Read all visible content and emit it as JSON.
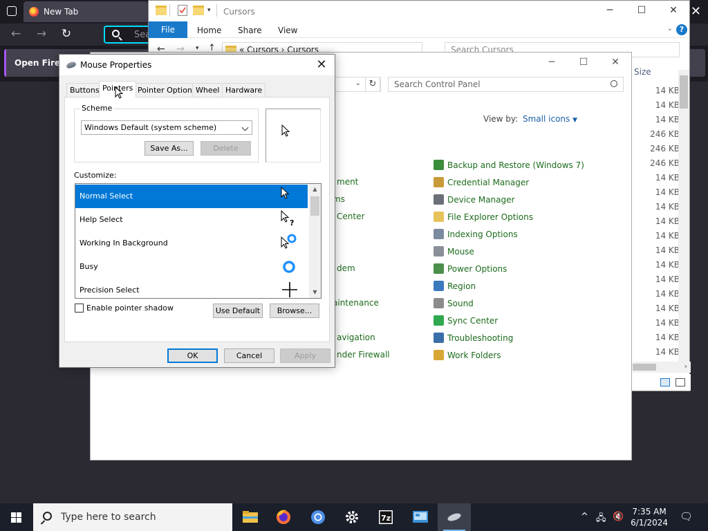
{
  "firefox": {
    "tab_title": "New Tab",
    "url_placeholder": "Sea",
    "notification": "Open Firefo"
  },
  "explorer": {
    "title": "Cursors",
    "ribbon": [
      "File",
      "Home",
      "Share",
      "View"
    ],
    "breadcrumb": "«  Cursors  ›  Cursors",
    "search_placeholder": "Search Cursors",
    "size_header": "Size",
    "sizes": [
      "14 KB",
      "14 KB",
      "14 KB",
      "246 KB",
      "246 KB",
      "246 KB",
      "14 KB",
      "14 KB",
      "14 KB",
      "14 KB",
      "14 KB",
      "14 KB",
      "14 KB",
      "14 KB",
      "14 KB",
      "14 KB",
      "14 KB",
      "14 KB",
      "14 KB"
    ]
  },
  "control_panel": {
    "search_placeholder": "Search Control Panel",
    "view_by_label": "View by:",
    "view_by_value": "Small icons",
    "left_partial": [
      "ment",
      "ms",
      "Center",
      "dem",
      "aintenance",
      "avigation",
      "nder Firewall"
    ],
    "items": [
      {
        "label": "Backup and Restore (Windows 7)",
        "icon": "backup-icon",
        "color": "#3a8d3a"
      },
      {
        "label": "Credential Manager",
        "icon": "credential-icon",
        "color": "#c89a3a"
      },
      {
        "label": "Device Manager",
        "icon": "device-manager-icon",
        "color": "#6b6f78"
      },
      {
        "label": "File Explorer Options",
        "icon": "folder-options-icon",
        "color": "#e6c35a"
      },
      {
        "label": "Indexing Options",
        "icon": "indexing-icon",
        "color": "#7a8aa0"
      },
      {
        "label": "Mouse",
        "icon": "mouse-icon",
        "color": "#8a8f98"
      },
      {
        "label": "Power Options",
        "icon": "power-icon",
        "color": "#4b8f4b"
      },
      {
        "label": "Region",
        "icon": "region-icon",
        "color": "#3c7ac0"
      },
      {
        "label": "Sound",
        "icon": "sound-icon",
        "color": "#8c8c8c"
      },
      {
        "label": "Sync Center",
        "icon": "sync-icon",
        "color": "#2fa84f"
      },
      {
        "label": "Troubleshooting",
        "icon": "troubleshooting-icon",
        "color": "#3a6ea8"
      },
      {
        "label": "Work Folders",
        "icon": "work-folders-icon",
        "color": "#d9a735"
      }
    ]
  },
  "dialog": {
    "title": "Mouse Properties",
    "tabs": [
      "Buttons",
      "Pointers",
      "Pointer Options",
      "Wheel",
      "Hardware"
    ],
    "active_tab": "Pointers",
    "scheme_label": "Scheme",
    "scheme_value": "Windows Default (system scheme)",
    "save_as": "Save As...",
    "delete": "Delete",
    "customize_label": "Customize:",
    "pointers": [
      "Normal Select",
      "Help Select",
      "Working In Background",
      "Busy",
      "Precision Select"
    ],
    "selected_pointer": "Normal Select",
    "shadow_label": "Enable pointer shadow",
    "shadow_checked": false,
    "use_default": "Use Default",
    "browse": "Browse...",
    "ok": "OK",
    "cancel": "Cancel",
    "apply": "Apply"
  },
  "taskbar": {
    "search_placeholder": "Type here to search",
    "apps": [
      "file-explorer-icon",
      "firefox-icon",
      "chromium-icon",
      "settings-icon",
      "7zip-icon",
      "control-panel-icon",
      "mouse-properties-icon"
    ],
    "time": "7:35 AM",
    "date": "6/1/2024"
  },
  "colors": {
    "accent": "#0078d7",
    "cp_link": "#1c6b1c",
    "taskbar": "#1a1f2a"
  }
}
